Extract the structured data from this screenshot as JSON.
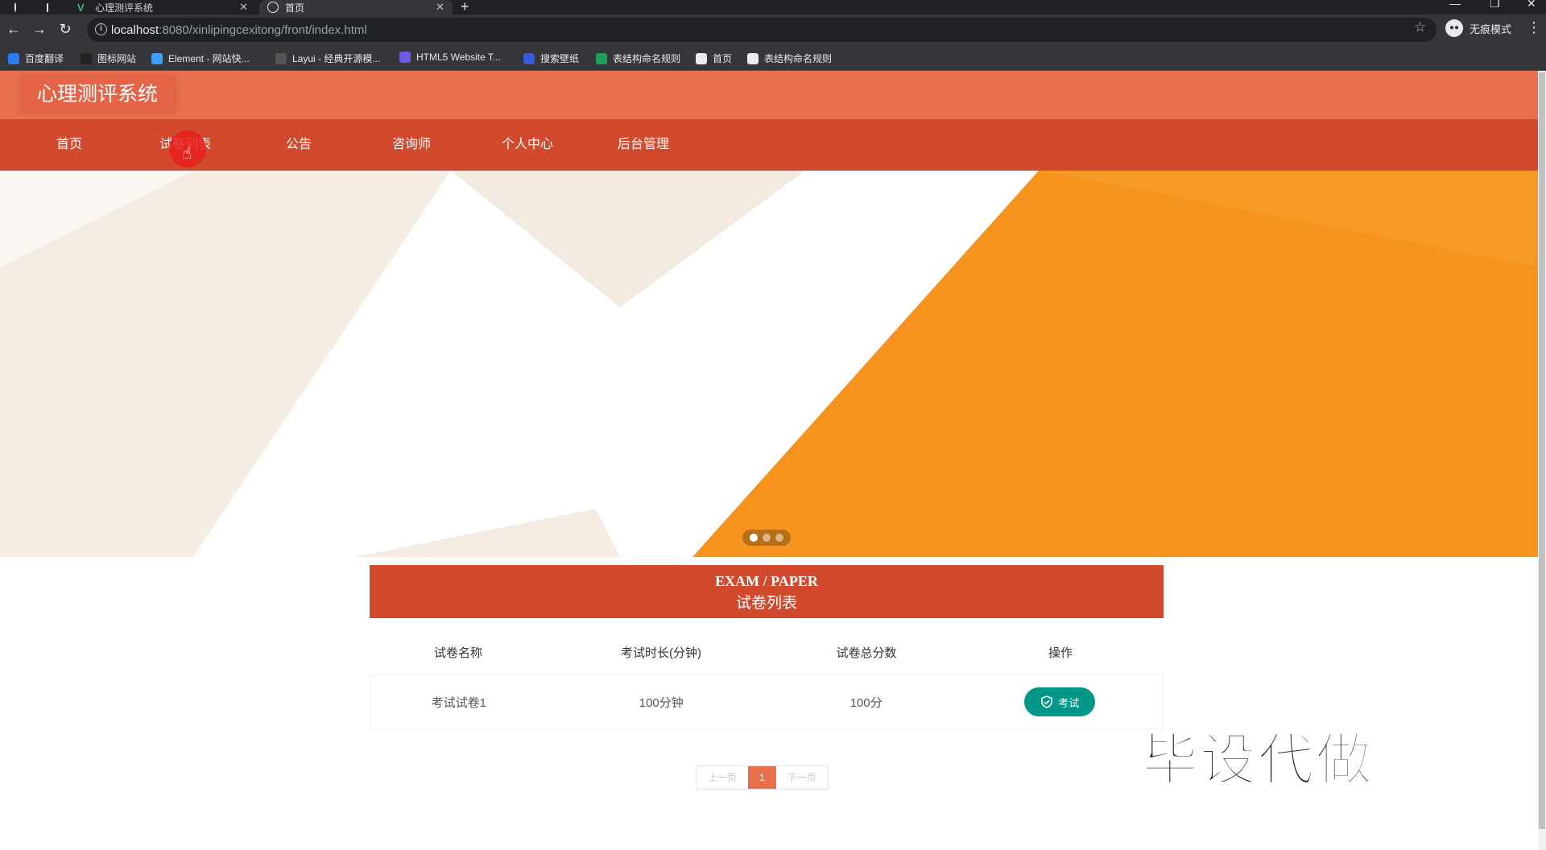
{
  "browser": {
    "tabs": [
      {
        "title": "心理测评系统",
        "active": false
      },
      {
        "title": "首页",
        "active": true
      }
    ],
    "address": {
      "host": "localhost",
      "path": ":8080/xinlipingcexitong/front/index.html"
    },
    "profile_label": "无痕模式",
    "bookmarks": [
      {
        "label": "百度翻译",
        "icon": "baidu-translate-icon",
        "color": "#2d7cf6"
      },
      {
        "label": "图标网站",
        "icon": "flag-icon",
        "color": "#222222"
      },
      {
        "label": "Element - 网站快...",
        "icon": "element-icon",
        "color": "#409eff"
      },
      {
        "label": "Layui - 经典开源模...",
        "icon": "layui-icon",
        "color": "#555555"
      },
      {
        "label": "HTML5 Website T...",
        "icon": "html5-icon",
        "color": "#6c5ce7"
      },
      {
        "label": "搜索壁纸",
        "icon": "wallpaper-icon",
        "color": "#3b5bdb"
      },
      {
        "label": "表结构命名规则",
        "icon": "sheet-icon",
        "color": "#1e9e58"
      },
      {
        "label": "首页",
        "icon": "globe-icon",
        "color": "#e8eaed"
      },
      {
        "label": "表结构命名规则",
        "icon": "globe-icon",
        "color": "#e8eaed"
      }
    ]
  },
  "site": {
    "logo": "心理测评系统",
    "nav": [
      {
        "label": "首页",
        "active": true
      },
      {
        "label": "试卷列表",
        "active": false
      },
      {
        "label": "公告",
        "active": false
      },
      {
        "label": "咨询师",
        "active": false
      },
      {
        "label": "个人中心",
        "active": false
      },
      {
        "label": "后台管理",
        "active": false
      }
    ],
    "carousel": {
      "slides": 3,
      "current": 1
    }
  },
  "exam": {
    "title_en": "EXAM / PAPER",
    "title_cn": "试卷列表",
    "columns": [
      "试卷名称",
      "考试时长(分钟)",
      "试卷总分数",
      "操作"
    ],
    "rows": [
      {
        "name": "考试试卷1",
        "duration": "100分钟",
        "score": "100分",
        "action": "考试"
      }
    ]
  },
  "pager": {
    "prev": "上一页",
    "current": "1",
    "next": "下一页"
  },
  "watermark": "毕设代做",
  "colors": {
    "header": "#e8704f",
    "nav": "#d24a2d",
    "accent_teal": "#009688",
    "banner_orange": "#f6931e"
  }
}
